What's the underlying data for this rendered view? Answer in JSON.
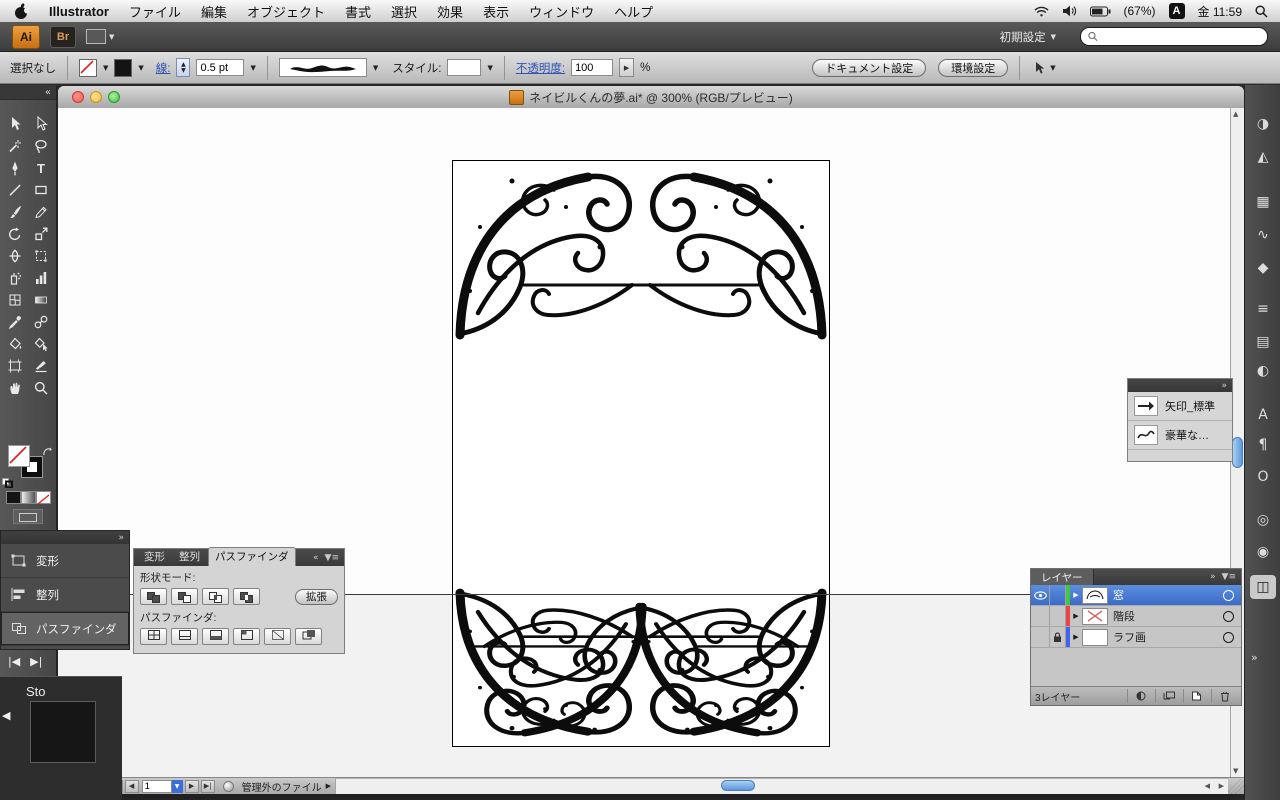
{
  "menubar": {
    "app_name": "Illustrator",
    "menus": [
      "ファイル",
      "編集",
      "オブジェクト",
      "書式",
      "選択",
      "効果",
      "表示",
      "ウィンドウ",
      "ヘルプ"
    ],
    "battery": "(67%)",
    "input_mode": "A",
    "clock": "金 11:59"
  },
  "appbar": {
    "ai_badge": "Ai",
    "br_badge": "Br",
    "workspace": "初期設定"
  },
  "controlbar": {
    "selection_status": "選択なし",
    "stroke_label": "線:",
    "stroke_width": "0.5 pt",
    "style_label": "スタイル:",
    "opacity_label": "不透明度:",
    "opacity_value": "100",
    "opacity_unit": "%",
    "document_setup": "ドキュメント設定",
    "preferences": "環境設定"
  },
  "document_window": {
    "title": "ネイビルくんの夢.ai* @ 300% (RGB/プレビュー)",
    "zoom": "300%",
    "page_number": "1",
    "file_status": "管理外のファイル"
  },
  "left_dock": {
    "buttons": [
      "変形",
      "整列",
      "パスファインダ"
    ]
  },
  "pathfinder_panel": {
    "tabs": [
      "変形",
      "整列",
      "パスファインダ"
    ],
    "shape_mode_label": "形状モード:",
    "expand_button": "拡張",
    "pathfinder_label": "パスファインダ:"
  },
  "brush_list_panel": {
    "items": [
      "矢印_標準",
      "豪華な…"
    ]
  },
  "layers_panel": {
    "tab": "レイヤー",
    "layers": [
      "窓",
      "階段",
      "ラフ画"
    ],
    "count_label": "3レイヤー"
  },
  "bottom_left_panel": {
    "label": "Sto"
  },
  "icons": {
    "dropdown": "▼",
    "spinner_up": "▲",
    "spinner_down": "▼",
    "collapse": "«",
    "expand": "»",
    "panel_menu": "▼≡",
    "nav_first": "|◀",
    "nav_prev": "◀",
    "nav_next": "▶",
    "nav_last": "▶|",
    "scroll_up": "▲",
    "scroll_down": "▼",
    "scroll_left": "◀",
    "scroll_right": "▶",
    "type_tool": "T",
    "dock": {
      "color": "◑",
      "color_guide": "◭",
      "swatches": "▦",
      "brushes": "∿",
      "symbols": "◆",
      "stroke": "≡",
      "gradient": "▤",
      "transparency": "◐",
      "appearance": "◉",
      "character": "A",
      "paragraph": "¶",
      "glyphs": "O",
      "attributes": "◎",
      "layers": "◫"
    }
  },
  "colors": {
    "accent_blue": "#3a6fd8",
    "aqua_scrollbar": "#7db8ec",
    "ai_orange": "#d9821f",
    "layer_colors": [
      "#43c843",
      "#ef4444",
      "#4464ef"
    ]
  }
}
